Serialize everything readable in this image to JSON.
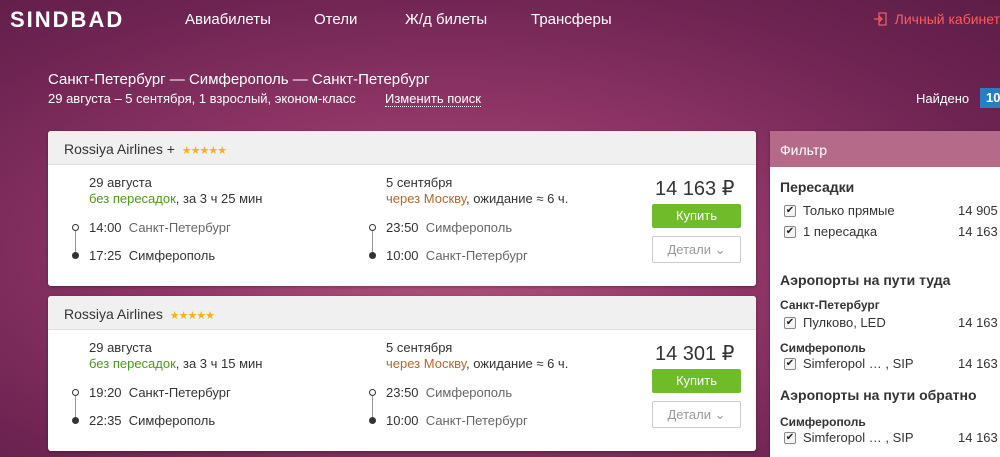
{
  "header": {
    "logo": "SINDBAD",
    "nav": [
      "Авиабилеты",
      "Отели",
      "Ж/д билеты",
      "Трансферы"
    ],
    "cabinet_label": "Личный кабинет"
  },
  "search": {
    "route": "Санкт-Петербург — Симферополь — Санкт-Петербург",
    "details": "29 августа – 5 сентября, 1 взрослый, эконом-класс",
    "change_label": "Изменить поиск",
    "found_label": "Найдено",
    "found_count": "10"
  },
  "results": [
    {
      "airline": "Rossiya Airlines +",
      "stars": "★★★★★",
      "out": {
        "date": "29 августа",
        "type": "без пересадок",
        "duration": ", за 3 ч 25 мин",
        "dep_time": "14:00",
        "dep_city": "Санкт-Петербург",
        "arr_time": "17:25",
        "arr_city": "Симферополь"
      },
      "ret": {
        "date": "5 сентября",
        "via": "через Москву",
        "wait": ", ожидание ≈ 6 ч.",
        "dep_time": "23:50",
        "dep_city": "Симферополь",
        "arr_time": "10:00",
        "arr_city": "Санкт-Петербург"
      },
      "price": "14 163 ₽",
      "buy_label": "Купить",
      "details_label": "Детали"
    },
    {
      "airline": "Rossiya Airlines",
      "stars": "★★★★★",
      "out": {
        "date": "29 августа",
        "type": "без пересадок",
        "duration": ", за 3 ч 15 мин",
        "dep_time": "19:20",
        "dep_city": "Санкт-Петербург",
        "arr_time": "22:35",
        "arr_city": "Симферополь"
      },
      "ret": {
        "date": "5 сентября",
        "via": "через Москву",
        "wait": ", ожидание ≈ 6 ч.",
        "dep_time": "23:50",
        "dep_city": "Симферополь",
        "arr_time": "10:00",
        "arr_city": "Санкт-Петербург"
      },
      "price": "14 301 ₽",
      "buy_label": "Купить",
      "details_label": "Детали"
    }
  ],
  "filter": {
    "title": "Фильтр",
    "transfers_title": "Пересадки",
    "transfers": [
      {
        "label": "Только прямые",
        "price": "14 905"
      },
      {
        "label": "1 пересадка",
        "price": "14 163"
      }
    ],
    "airports_there_title": "Аэропорты на пути туда",
    "there_group": "Санкт-Петербург",
    "there_item": {
      "label": "Пулково, LED",
      "price": "14 163"
    },
    "there_group2": "Симферополь",
    "there_item2": {
      "label": "Simferopol … , SIP",
      "price": "14 163"
    },
    "airports_back_title": "Аэропорты на пути обратно",
    "back_group": "Симферополь",
    "back_item": {
      "label": "Simferopol … , SIP",
      "price": "14 163"
    }
  },
  "colors": {
    "accent_green": "#6fbb2a",
    "cabinet_red": "#ff5b5b",
    "filter_header": "#b66a8a",
    "badge_blue": "#2a7ebf"
  }
}
